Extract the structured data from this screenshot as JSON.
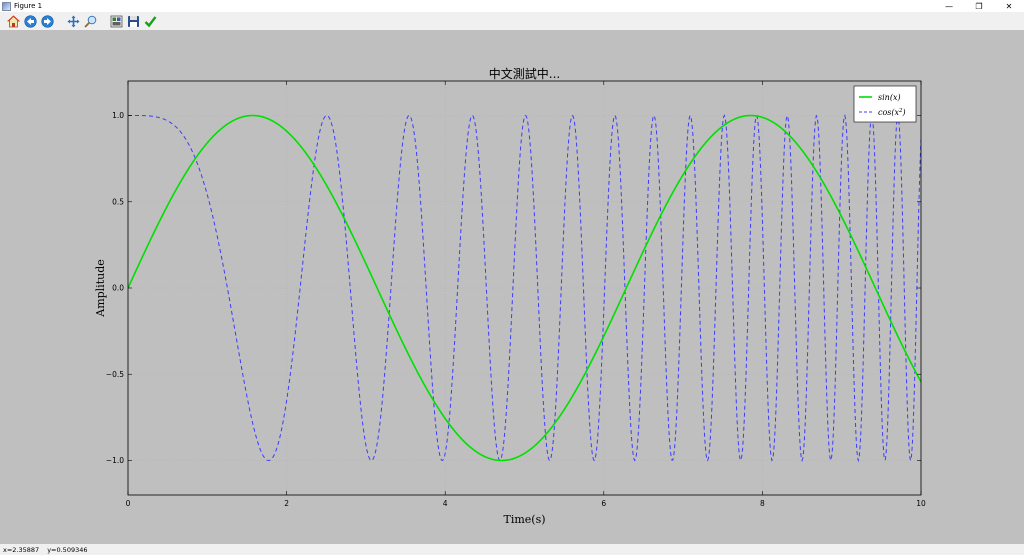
{
  "window": {
    "title": "Figure 1",
    "controls": {
      "minimize": "—",
      "maximize": "❐",
      "close": "✕"
    }
  },
  "toolbar": {
    "buttons": [
      {
        "name": "home-button",
        "icon": "home-icon"
      },
      {
        "name": "back-button",
        "icon": "back-arrow-icon"
      },
      {
        "name": "forward-button",
        "icon": "forward-arrow-icon"
      },
      {
        "name": "pan-button",
        "icon": "pan-icon"
      },
      {
        "name": "zoom-button",
        "icon": "zoom-icon"
      },
      {
        "name": "configure-subplots-button",
        "icon": "subplots-icon"
      },
      {
        "name": "save-button",
        "icon": "save-icon"
      },
      {
        "name": "edit-parameters-button",
        "icon": "checkmark-icon"
      }
    ]
  },
  "status": {
    "x_readout": "x=2.35887",
    "y_readout": "y=0.509346"
  },
  "colors": {
    "sin": "#00e000",
    "cos": "#3c3cff",
    "grid": "#b0b0b0",
    "background": "#bfbfbf"
  },
  "chart_data": {
    "type": "line",
    "title": "中文測試中...",
    "xlabel": "Time(s)",
    "ylabel": "Amplitude",
    "xlim": [
      0,
      10
    ],
    "ylim": [
      -1.2,
      1.2
    ],
    "xticks": [
      0,
      2,
      4,
      6,
      8,
      10
    ],
    "yticks": [
      -1.0,
      -0.5,
      0.0,
      0.5,
      1.0
    ],
    "xtick_labels": [
      "0",
      "2",
      "4",
      "6",
      "8",
      "10"
    ],
    "ytick_labels": [
      "−1.0",
      "−0.5",
      "0.0",
      "0.5",
      "1.0"
    ],
    "grid": true,
    "legend_position": "top-right",
    "x_sample_count": 1000,
    "series": [
      {
        "name": "sin(x)",
        "legend_label": "sin(x)",
        "formula": "sin(x)",
        "style": "solid",
        "color": "#00e000"
      },
      {
        "name": "cos(x²)",
        "legend_label": "cos(x",
        "legend_sup": "2",
        "legend_close": ")",
        "formula": "cos(x^2)",
        "style": "dashed",
        "color": "#3c3cff"
      }
    ]
  }
}
